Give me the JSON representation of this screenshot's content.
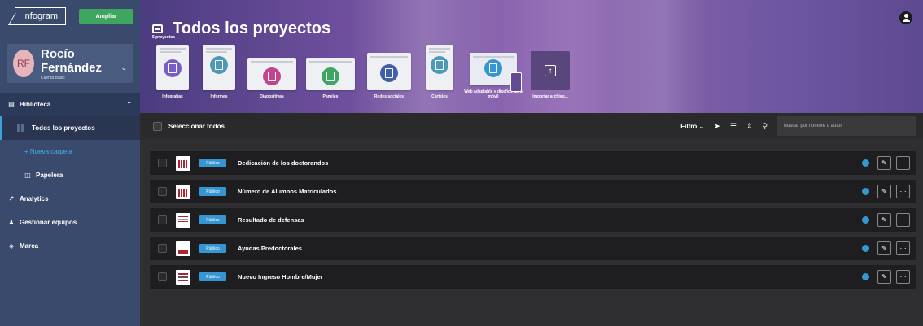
{
  "sidebar": {
    "logo": "infogram",
    "upgrade_label": "Ampliar",
    "user": {
      "initials": "RF",
      "name": "Rocío Fernández",
      "plan": "Cuenta Basic"
    },
    "library_label": "Biblioteca",
    "all_projects_label": "Todos los proyectos",
    "new_folder_label": "+ Nueva carpeta",
    "trash_label": "Papelera",
    "analytics_label": "Analytics",
    "teams_label": "Gestionar equipos",
    "brand_label": "Marca"
  },
  "header": {
    "title": "Todos los proyectos",
    "subtitle": "5 proyectos",
    "types": [
      {
        "label": "Infografías",
        "color": "#7a5cc6"
      },
      {
        "label": "Informes",
        "color": "#4d9ab6"
      },
      {
        "label": "Diapositivas",
        "color": "#c2458b"
      },
      {
        "label": "Paneles",
        "color": "#3fa662"
      },
      {
        "label": "Redes sociales",
        "color": "#3f5fa8"
      },
      {
        "label": "Carteles",
        "color": "#4d9ab6"
      },
      {
        "label": "Web adaptable y diseños para móvil",
        "color": "#3596d2"
      },
      {
        "label": "Importar archivo..."
      }
    ]
  },
  "toolbar": {
    "select_all_label": "Seleccionar todos",
    "filter_label": "Filtro",
    "search_placeholder": "Buscar por nombre o autor"
  },
  "projects": [
    {
      "title": "Dedicación de los doctorandos",
      "badge": "Público",
      "thumb": "bars"
    },
    {
      "title": "Número de Alumnos Matriculados",
      "badge": "Público",
      "thumb": "bars"
    },
    {
      "title": "Resultado de defensas",
      "badge": "Público",
      "thumb": "lines"
    },
    {
      "title": "Ayudas Predoctorales",
      "badge": "Público",
      "thumb": "bottom"
    },
    {
      "title": "Nuevo Ingreso Hombre/Mujer",
      "badge": "Público",
      "thumb": "stripes"
    }
  ]
}
